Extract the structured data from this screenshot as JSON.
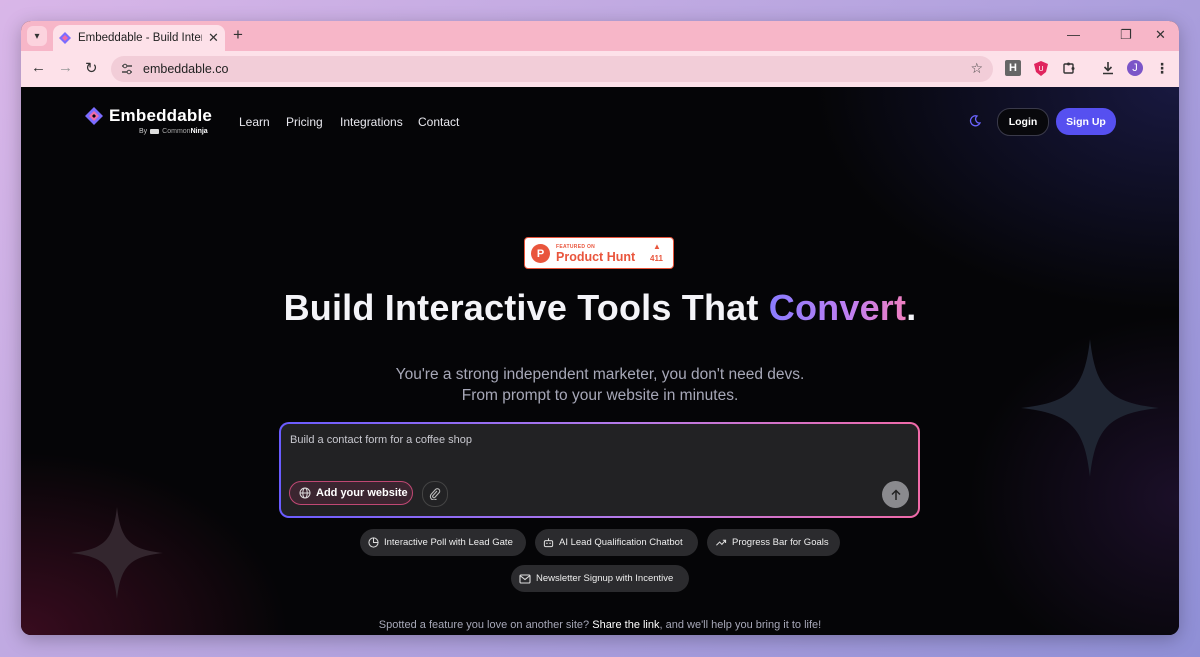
{
  "browser": {
    "tab_title": "Embeddable - Build Interactive",
    "url": "embeddable.co",
    "extension_h_label": "H",
    "profile_initial": "J"
  },
  "header": {
    "logo_text": "Embeddable",
    "byline_prefix": "By",
    "byline_brand_light": "Common",
    "byline_brand_bold": "Ninja",
    "nav": [
      "Learn",
      "Pricing",
      "Integrations",
      "Contact"
    ],
    "login_label": "Login",
    "signup_label": "Sign Up"
  },
  "product_hunt": {
    "small": "FEATURED ON",
    "name": "Product Hunt",
    "count": "411",
    "logo_letter": "P",
    "color": "#e9553c"
  },
  "hero": {
    "headline_main": "Build Interactive Tools That ",
    "headline_accent": "Convert",
    "headline_end": ".",
    "sub_line1": "You're a strong independent marketer, you don't need devs.",
    "sub_line2": "From prompt to your website in minutes."
  },
  "prompt": {
    "text": "Build a contact form for a coffee shop",
    "add_website_label": "Add your website"
  },
  "suggestions": [
    {
      "label": "Interactive Poll with Lead Gate",
      "icon": "pie-chart-icon"
    },
    {
      "label": "AI Lead Qualification Chatbot",
      "icon": "bot-icon"
    },
    {
      "label": "Progress Bar for Goals",
      "icon": "trend-up-icon"
    },
    {
      "label": "Newsletter Signup with Incentive",
      "icon": "mail-icon"
    }
  ],
  "footer": {
    "before": "Spotted a feature you love on another site? ",
    "link": "Share the link",
    "after": ", and we'll help you bring it to life!"
  },
  "colors": {
    "accent_signup": "#5650f0",
    "tab_bar": "#f7b6c8",
    "toolbar": "#fde1e9"
  }
}
